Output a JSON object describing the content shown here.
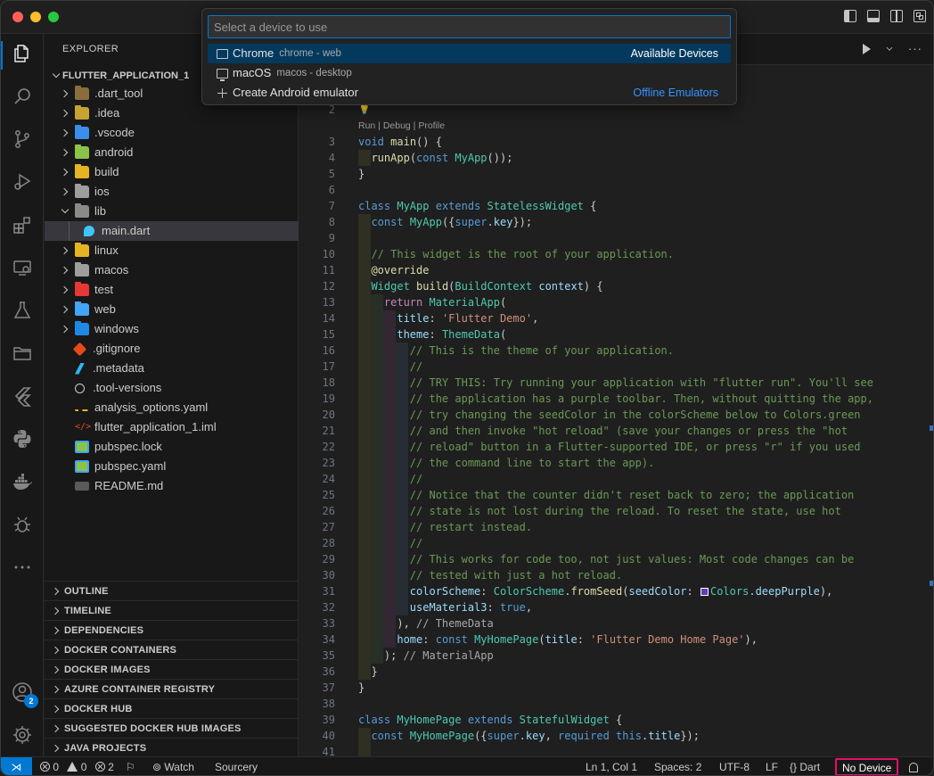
{
  "quickpick": {
    "placeholder": "Select a device to use",
    "items": [
      {
        "label": "Chrome",
        "desc": "chrome - web",
        "separator": "Available Devices"
      },
      {
        "label": "macOS",
        "desc": "macos - desktop",
        "separator": ""
      },
      {
        "label": "Create Android emulator",
        "desc": "",
        "separator": "Offline Emulators"
      }
    ]
  },
  "sidebar": {
    "title": "EXPLORER",
    "root": "FLUTTER_APPLICATION_1",
    "tree": [
      {
        "name": ".dart_tool",
        "type": "folder",
        "color": "#8a6d3b"
      },
      {
        "name": ".idea",
        "type": "folder",
        "color": "#c6a332"
      },
      {
        "name": ".vscode",
        "type": "folder",
        "color": "#3b8eea"
      },
      {
        "name": "android",
        "type": "folder",
        "color": "#8bc34a"
      },
      {
        "name": "build",
        "type": "folder",
        "color": "#e6b422"
      },
      {
        "name": "ios",
        "type": "folder",
        "color": "#9e9e9e"
      },
      {
        "name": "lib",
        "type": "folder-open",
        "color": "#8a8a8a"
      },
      {
        "name": "main.dart",
        "type": "file",
        "color": "#40c4ff"
      },
      {
        "name": "linux",
        "type": "folder",
        "color": "#e6b422"
      },
      {
        "name": "macos",
        "type": "folder",
        "color": "#9e9e9e"
      },
      {
        "name": "test",
        "type": "folder",
        "color": "#e53935"
      },
      {
        "name": "web",
        "type": "folder",
        "color": "#42a5f5"
      },
      {
        "name": "windows",
        "type": "folder",
        "color": "#1e88e5"
      },
      {
        "name": ".gitignore",
        "type": "file",
        "color": "#e64a19"
      },
      {
        "name": ".metadata",
        "type": "file",
        "color": "#29b6f6"
      },
      {
        "name": ".tool-versions",
        "type": "file",
        "color": "#cccccc"
      },
      {
        "name": "analysis_options.yaml",
        "type": "file",
        "color": "#e6b422"
      },
      {
        "name": "flutter_application_1.iml",
        "type": "file",
        "color": "#e64a19"
      },
      {
        "name": "pubspec.lock",
        "type": "file",
        "color": "#8bc34a"
      },
      {
        "name": "pubspec.yaml",
        "type": "file",
        "color": "#8bc34a"
      },
      {
        "name": "README.md",
        "type": "file",
        "color": "#7a7a7a"
      }
    ],
    "panels": [
      "OUTLINE",
      "TIMELINE",
      "DEPENDENCIES",
      "DOCKER CONTAINERS",
      "DOCKER IMAGES",
      "AZURE CONTAINER REGISTRY",
      "DOCKER HUB",
      "SUGGESTED DOCKER HUB IMAGES",
      "JAVA PROJECTS"
    ]
  },
  "activity": {
    "account_badge": "2",
    "icons": [
      "files-icon",
      "search-icon",
      "source-control-icon",
      "run-debug-icon",
      "extensions-icon",
      "remote-explorer-icon",
      "testing-icon",
      "folder-icon",
      "flutter-icon",
      "python-icon",
      "docker-icon",
      "bug-icon",
      "more-icon",
      "account-icon",
      "gear-icon"
    ]
  },
  "editor": {
    "code_lens": "Run | Debug | Profile",
    "first_line_number": "2"
  },
  "statusbar": {
    "errors": "0",
    "warnings": "0",
    "info": "2",
    "watch": "Watch",
    "sourcery": "Sourcery",
    "cursor": "Ln 1, Col 1",
    "spaces": "Spaces: 2",
    "encoding": "UTF-8",
    "eol": "LF",
    "language": "Dart",
    "device": "No Device"
  },
  "colors": {
    "accent": "#0078d4",
    "highlight_border": "#e0116b",
    "selected_item": "#04395e"
  }
}
